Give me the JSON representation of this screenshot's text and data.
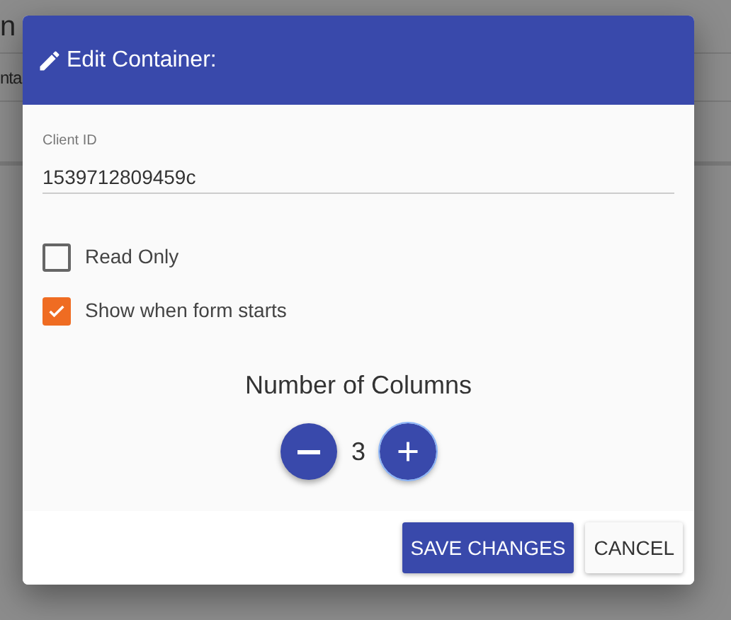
{
  "background": {
    "title": "n",
    "field": "nta"
  },
  "dialog": {
    "title": "Edit Container:",
    "client_id": {
      "label": "Client ID",
      "value": "1539712809459c"
    },
    "options": [
      {
        "label": "Read Only",
        "checked": false
      },
      {
        "label": "Show when form starts",
        "checked": true
      }
    ],
    "columns": {
      "title": "Number of Columns",
      "value": "3"
    },
    "buttons": [
      {
        "label": "SAVE CHANGES",
        "kind": "primary"
      },
      {
        "label": "CANCEL",
        "kind": "secondary"
      }
    ]
  }
}
